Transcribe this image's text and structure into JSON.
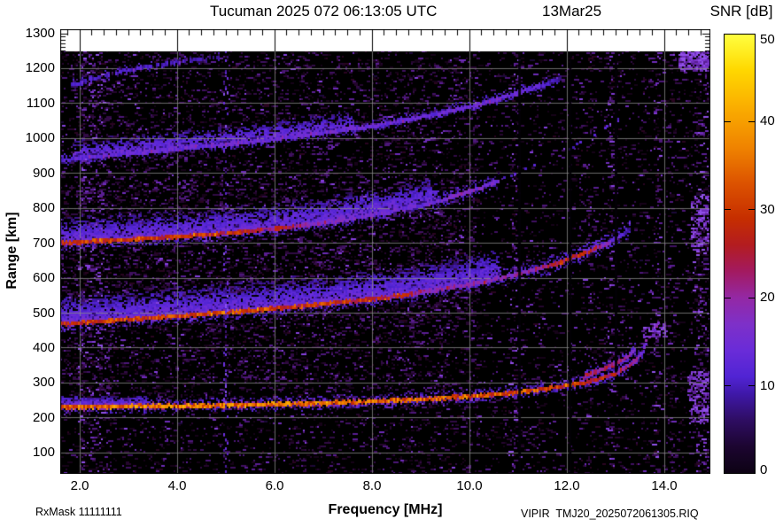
{
  "header": {
    "title": "Tucuman 2025 072 06:13:05 UTC",
    "date": "13Mar25"
  },
  "colorbar": {
    "title": "SNR [dB]",
    "ticks": [
      0,
      10,
      20,
      30,
      40,
      50
    ]
  },
  "axes": {
    "x": {
      "label": "Frequency [MHz]",
      "tick_labels": [
        "2.0",
        "4.0",
        "6.0",
        "8.0",
        "10.0",
        "12.0",
        "14.0"
      ],
      "tick_values": [
        2,
        4,
        6,
        8,
        10,
        12,
        14
      ],
      "minor_step": 0.25
    },
    "y": {
      "label": "Range [km]",
      "tick_values": [
        100,
        200,
        300,
        400,
        500,
        600,
        700,
        800,
        900,
        1000,
        1100,
        1200,
        1300
      ],
      "minor_step": 10
    }
  },
  "footer": {
    "rx_mask": "RxMask 11111111",
    "file": "VIPIR  TMJ20_2025072061305.RIQ"
  },
  "chart_data": {
    "type": "heatmap",
    "title": "Tucuman 2025 072 06:13:05 UTC",
    "station": "Tucuman",
    "date": "13Mar25",
    "xlabel": "Frequency [MHz]",
    "ylabel": "Range [km]",
    "value_label": "SNR [dB]",
    "xlim": [
      1.6,
      14.95
    ],
    "ylim": [
      40,
      1313
    ],
    "data_top_km": 1250,
    "grid": true,
    "snr_scale": {
      "min": 0,
      "max": 50,
      "stops": [
        [
          0,
          "#0d0214"
        ],
        [
          3,
          "#1c0530"
        ],
        [
          6,
          "#2e0d62"
        ],
        [
          9,
          "#3f18a8"
        ],
        [
          11,
          "#5124d4"
        ],
        [
          14,
          "#6a2cd8"
        ],
        [
          17,
          "#7e30c8"
        ],
        [
          20,
          "#9428a4"
        ],
        [
          23,
          "#a31a60"
        ],
        [
          26,
          "#b31c20"
        ],
        [
          29,
          "#c62e00"
        ],
        [
          33,
          "#dc5200"
        ],
        [
          37,
          "#ef8200"
        ],
        [
          42,
          "#fbb000"
        ],
        [
          46,
          "#ffd800"
        ],
        [
          50,
          "#ffff40"
        ]
      ]
    },
    "traces": [
      {
        "name": "F-layer 1-hop echo (O-mode)",
        "points": [
          [
            1.6,
            231
          ],
          [
            2.5,
            232
          ],
          [
            4,
            234
          ],
          [
            5.5,
            237
          ],
          [
            7,
            242
          ],
          [
            8,
            247
          ],
          [
            9,
            253
          ],
          [
            10,
            261
          ],
          [
            10.8,
            270
          ],
          [
            11.5,
            281
          ],
          [
            12.0,
            292
          ],
          [
            12.4,
            303
          ],
          [
            12.8,
            317
          ],
          [
            13.05,
            330
          ],
          [
            13.25,
            346
          ],
          [
            13.4,
            362
          ],
          [
            13.5,
            378
          ],
          [
            13.57,
            392
          ]
        ],
        "brightness": [
          [
            1.6,
            33
          ],
          [
            2.2,
            36
          ],
          [
            4,
            36
          ],
          [
            6,
            35
          ],
          [
            8,
            34
          ],
          [
            10,
            33
          ],
          [
            11.5,
            32
          ],
          [
            12.3,
            30
          ],
          [
            12.9,
            27
          ],
          [
            13.2,
            22
          ],
          [
            13.45,
            18
          ],
          [
            13.57,
            15
          ]
        ],
        "halo": {
          "spread": 5,
          "p": 0.5
        }
      },
      {
        "name": "F-layer 1-hop echo (X-mode branch)",
        "points": [
          [
            12.35,
            318
          ],
          [
            12.7,
            336
          ],
          [
            12.95,
            352
          ],
          [
            13.15,
            367
          ],
          [
            13.3,
            381
          ],
          [
            13.42,
            395
          ]
        ],
        "brightness": [
          [
            12.35,
            22
          ],
          [
            12.7,
            24
          ],
          [
            13.05,
            22
          ],
          [
            13.3,
            17
          ],
          [
            13.42,
            13
          ]
        ],
        "halo": {
          "spread": 4,
          "p": 0.4
        }
      },
      {
        "name": "F-layer 2-hop echo",
        "points": [
          [
            1.6,
            468
          ],
          [
            2.5,
            477
          ],
          [
            4,
            491
          ],
          [
            5.5,
            507
          ],
          [
            7,
            526
          ],
          [
            8,
            540
          ],
          [
            8.6,
            550
          ],
          [
            9.3,
            566
          ],
          [
            10,
            582
          ],
          [
            10.7,
            602
          ],
          [
            11.3,
            622
          ],
          [
            11.8,
            642
          ],
          [
            12.2,
            662
          ],
          [
            12.6,
            684
          ],
          [
            12.95,
            708
          ],
          [
            13.3,
            738
          ]
        ],
        "brightness": [
          [
            1.6,
            27
          ],
          [
            2.2,
            30
          ],
          [
            5,
            30
          ],
          [
            7.5,
            29
          ],
          [
            8.6,
            26
          ],
          [
            9.2,
            20
          ],
          [
            10,
            18
          ],
          [
            10.8,
            18
          ],
          [
            11.6,
            22
          ],
          [
            12,
            27
          ],
          [
            12.5,
            26
          ],
          [
            12.8,
            18
          ],
          [
            13.1,
            12
          ],
          [
            13.3,
            9
          ]
        ],
        "halo": {
          "spread": 7,
          "p": 0.6
        }
      },
      {
        "name": "F-layer 3-hop echo",
        "points": [
          [
            1.6,
            700
          ],
          [
            2.5,
            707
          ],
          [
            4,
            718
          ],
          [
            5,
            728
          ],
          [
            6,
            741
          ],
          [
            7,
            758
          ],
          [
            8,
            780
          ],
          [
            8.8,
            802
          ],
          [
            9.4,
            822
          ],
          [
            10,
            848
          ],
          [
            10.35,
            864
          ],
          [
            10.6,
            878
          ]
        ],
        "brightness": [
          [
            1.6,
            28
          ],
          [
            3,
            29
          ],
          [
            5,
            28
          ],
          [
            6.2,
            24
          ],
          [
            7,
            17
          ],
          [
            8,
            15
          ],
          [
            9,
            14
          ],
          [
            9.7,
            16
          ],
          [
            10.2,
            17
          ],
          [
            10.6,
            14
          ]
        ],
        "halo": {
          "spread": 6,
          "p": 0.55
        }
      },
      {
        "name": "F-layer 4-hop echo",
        "points": [
          [
            1.6,
            938
          ],
          [
            2.5,
            950
          ],
          [
            4,
            970
          ],
          [
            5.5,
            990
          ],
          [
            7,
            1015
          ],
          [
            8,
            1035
          ],
          [
            8.7,
            1052
          ],
          [
            9.4,
            1072
          ],
          [
            10,
            1090
          ],
          [
            10.6,
            1112
          ],
          [
            11.1,
            1135
          ],
          [
            11.5,
            1152
          ],
          [
            11.9,
            1172
          ]
        ],
        "brightness": [
          [
            1.6,
            12
          ],
          [
            2.5,
            13
          ],
          [
            4,
            14
          ],
          [
            6,
            14
          ],
          [
            8,
            14
          ],
          [
            9.2,
            13
          ],
          [
            9.8,
            15
          ],
          [
            10.6,
            15
          ],
          [
            11.2,
            13
          ],
          [
            11.6,
            10
          ],
          [
            11.9,
            7
          ]
        ],
        "halo": {
          "spread": 4,
          "p": 0.35
        }
      },
      {
        "name": "F-layer 5-hop echo (faint)",
        "points": [
          [
            1.8,
            1152
          ],
          [
            2.3,
            1172
          ],
          [
            2.9,
            1192
          ],
          [
            3.5,
            1208
          ],
          [
            4.2,
            1222
          ],
          [
            4.9,
            1234
          ]
        ],
        "brightness": [
          [
            1.8,
            10
          ],
          [
            3,
            11
          ],
          [
            4.2,
            10
          ],
          [
            4.9,
            8
          ]
        ],
        "sparse": 0.5,
        "halo": {
          "spread": 3,
          "p": 0.2
        }
      }
    ],
    "dot_trails": [
      {
        "name": "1-hop O-mode asymptote dots",
        "points": [
          [
            13.55,
            400
          ],
          [
            13.63,
            420
          ],
          [
            13.7,
            440
          ],
          [
            13.78,
            458
          ],
          [
            13.86,
            475
          ]
        ],
        "p": 0.5,
        "v": [
          14,
          21
        ]
      },
      {
        "name": "1-hop X-mode asymptote dots",
        "points": [
          [
            13.45,
            405
          ],
          [
            13.55,
            428
          ],
          [
            13.63,
            448
          ]
        ],
        "p": 0.45,
        "v": [
          13,
          19
        ]
      },
      {
        "name": "3-hop asymptote dots",
        "points": [
          [
            10.7,
            885
          ],
          [
            11.1,
            912
          ],
          [
            11.6,
            942
          ],
          [
            12.1,
            975
          ],
          [
            12.55,
            1010
          ],
          [
            12.9,
            1042
          ],
          [
            13.12,
            1062
          ]
        ],
        "p": 0.35,
        "v": [
          9,
          14
        ]
      }
    ],
    "diffuse_clouds": [
      {
        "trace": 2,
        "f0": 1.6,
        "f1": 10.6,
        "up": 85,
        "n": 5200
      },
      {
        "trace": 3,
        "f0": 1.6,
        "f1": 9.3,
        "up": 75,
        "n": 3600
      },
      {
        "trace": 4,
        "f0": 1.9,
        "f1": 7.6,
        "up": 52,
        "n": 1400
      },
      {
        "trace": 0,
        "f0": 1.6,
        "f1": 3.4,
        "up": 30,
        "n": 500
      }
    ],
    "interference_lines": [
      {
        "f": 5.0
      }
    ],
    "dropout_columns": [
      {
        "f": 11.02,
        "r0": 40,
        "r1": 1250
      },
      {
        "f": 12.06,
        "r0": 40,
        "r1": 1250
      },
      {
        "f": 13.0,
        "r0": 330,
        "r1": 1250
      }
    ],
    "noise_columns": [
      {
        "f": 2.07,
        "boost": 1.5
      },
      {
        "f": 2.25,
        "boost": 1.2
      },
      {
        "f": 2.42,
        "boost": 1.0
      },
      {
        "f": 2.58,
        "boost": 0.8
      },
      {
        "f": 3.09,
        "boost": 0.5
      },
      {
        "f": 8.8,
        "boost": 0.7
      },
      {
        "f": 8.95,
        "boost": 0.5
      },
      {
        "f": 10.93,
        "boost": 1.2
      },
      {
        "f": 11.45,
        "boost": 0.5
      },
      {
        "f": 12.47,
        "boost": 0.6
      },
      {
        "f": 12.9,
        "boost": 1.1
      },
      {
        "f": 13.84,
        "boost": 1.2
      },
      {
        "f": 14.13,
        "boost": 0.6
      },
      {
        "f": 14.69,
        "boost": 1.4
      },
      {
        "f": 14.84,
        "boost": 1.0
      }
    ],
    "noise_bursts": [
      {
        "f0": 14.3,
        "f1": 14.95,
        "r0": 1195,
        "r1": 1250,
        "n": 260
      },
      {
        "f0": 14.55,
        "f1": 14.95,
        "r0": 680,
        "r1": 840,
        "n": 140
      },
      {
        "f0": 14.5,
        "f1": 14.95,
        "r0": 185,
        "r1": 335,
        "n": 200
      },
      {
        "f0": 13.55,
        "f1": 14.05,
        "r0": 430,
        "r1": 470,
        "n": 60
      }
    ],
    "background_noise": {
      "candidates": 36000,
      "palette": [
        [
          "#160318",
          22
        ],
        [
          "#24062e",
          18
        ],
        [
          "#310b44",
          16
        ],
        [
          "#3f1160",
          13
        ],
        [
          "#4c1778",
          10
        ],
        [
          "#5a1e92",
          8
        ],
        [
          "#2a0520",
          6
        ],
        [
          "#6e2cba",
          4
        ],
        [
          "#8440dc",
          2
        ],
        [
          "#1c0a3a",
          1
        ]
      ],
      "bright_palette": [
        "#6e2cba",
        "#7e38d0",
        "#9050e8",
        "#5a1e92"
      ]
    }
  }
}
